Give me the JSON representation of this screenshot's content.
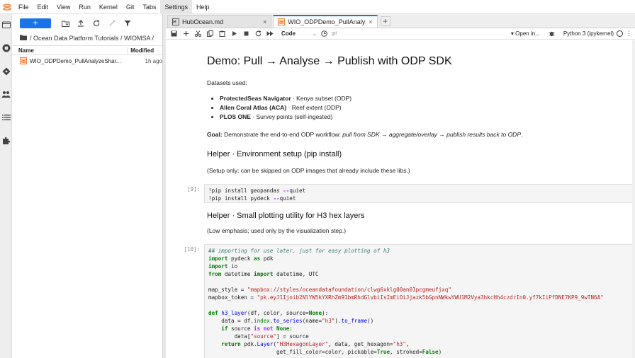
{
  "menubar": {
    "items": [
      "File",
      "Edit",
      "View",
      "Run",
      "Kernel",
      "Git",
      "Tabs",
      "Settings",
      "Help"
    ],
    "active": "Settings"
  },
  "filebrowser": {
    "new_label": "+",
    "breadcrumb": "/ Ocean Data Platform Tutorials / WIOMSA /",
    "columns": {
      "name": "Name",
      "modified": "Modified"
    },
    "files": [
      {
        "name": "WIO_ODPDemo_PullAnalyzeShar...",
        "modified": "1h ago"
      }
    ]
  },
  "tabs": [
    {
      "label": "HubOcean.md",
      "close": "×"
    },
    {
      "label": "WIO_ODPDemo_PullAnalyz",
      "close": "×"
    }
  ],
  "tab_add": "+",
  "nbtoolbar": {
    "cell_type": "Code",
    "git": "git",
    "open_in": "▾ Open in...",
    "kernel": "Python 3 (ipykernel)"
  },
  "notebook": {
    "title": "Demo: Pull → Analyse → Publish with ODP SDK",
    "datasets_intro": "Datasets used:",
    "datasets": [
      {
        "name": "ProtectedSeas Navigator",
        "desc": " · Kenya subset (ODP)"
      },
      {
        "name": "Allen Coral Atlas (ACA)",
        "desc": " · Reef extent (ODP)"
      },
      {
        "name": "PLOS ONE",
        "desc": " · Survey points (self-ingested)"
      }
    ],
    "goal_label": "Goal:",
    "goal_text": " Demonstrate the end-to-end ODP workflow: ",
    "goal_em": "pull from SDK → aggregate/overlay → publish results back to ODP",
    "goal_end": ".",
    "helper1_title": "Helper · Environment setup (pip install)",
    "helper1_note": "(Setup only; can be skipped on ODP images that already include these libs.)",
    "cell1_prompt": "[9]:",
    "helper2_title": "Helper · Small plotting utility for H3 hex layers",
    "helper2_note": "(Low emphasis; used only by the visualization step.)",
    "cell2_prompt": "[10]:"
  }
}
